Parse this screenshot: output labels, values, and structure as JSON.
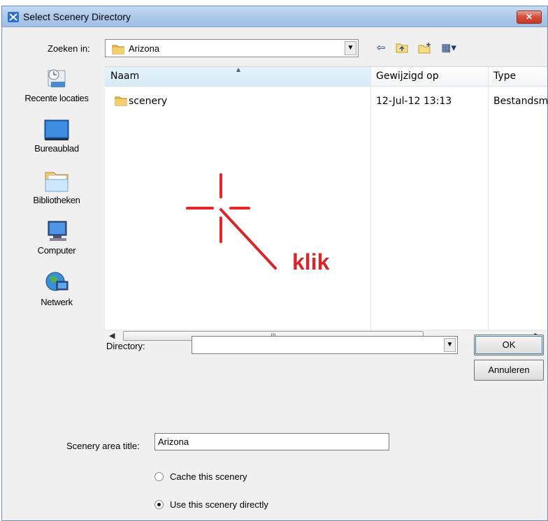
{
  "window": {
    "title": "Select Scenery Directory",
    "close_glyph": "✕"
  },
  "lookin": {
    "label": "Zoeken in:",
    "value": "Arizona"
  },
  "toolbar": {
    "back_glyph": "⇦",
    "up_glyph": "📁",
    "newfolder_glyph": "✱",
    "views_glyph": "▦▾"
  },
  "places": [
    {
      "label": "Recente locaties",
      "icon": "recent-locations-icon"
    },
    {
      "label": "Bureaublad",
      "icon": "desktop-icon"
    },
    {
      "label": "Bibliotheken",
      "icon": "libraries-icon"
    },
    {
      "label": "Computer",
      "icon": "computer-icon"
    },
    {
      "label": "Netwerk",
      "icon": "network-icon"
    }
  ],
  "filelist": {
    "columns": [
      "Naam",
      "Gewijzigd op",
      "Type"
    ],
    "rows": [
      {
        "name": "scenery",
        "modified": "12-Jul-12 13:13",
        "type": "Bestandsm"
      }
    ],
    "scroll_thumb": "III"
  },
  "directory": {
    "label": "Directory:",
    "value": ""
  },
  "buttons": {
    "ok": "OK",
    "cancel": "Annuleren"
  },
  "scenery_title": {
    "label": "Scenery area title:",
    "value": "Arizona"
  },
  "options": {
    "cache": {
      "label": "Cache this scenery",
      "checked": false
    },
    "direct": {
      "label": "Use this scenery directly",
      "checked": true
    }
  },
  "annotation": {
    "text": "klik",
    "color": "#d9262a"
  }
}
